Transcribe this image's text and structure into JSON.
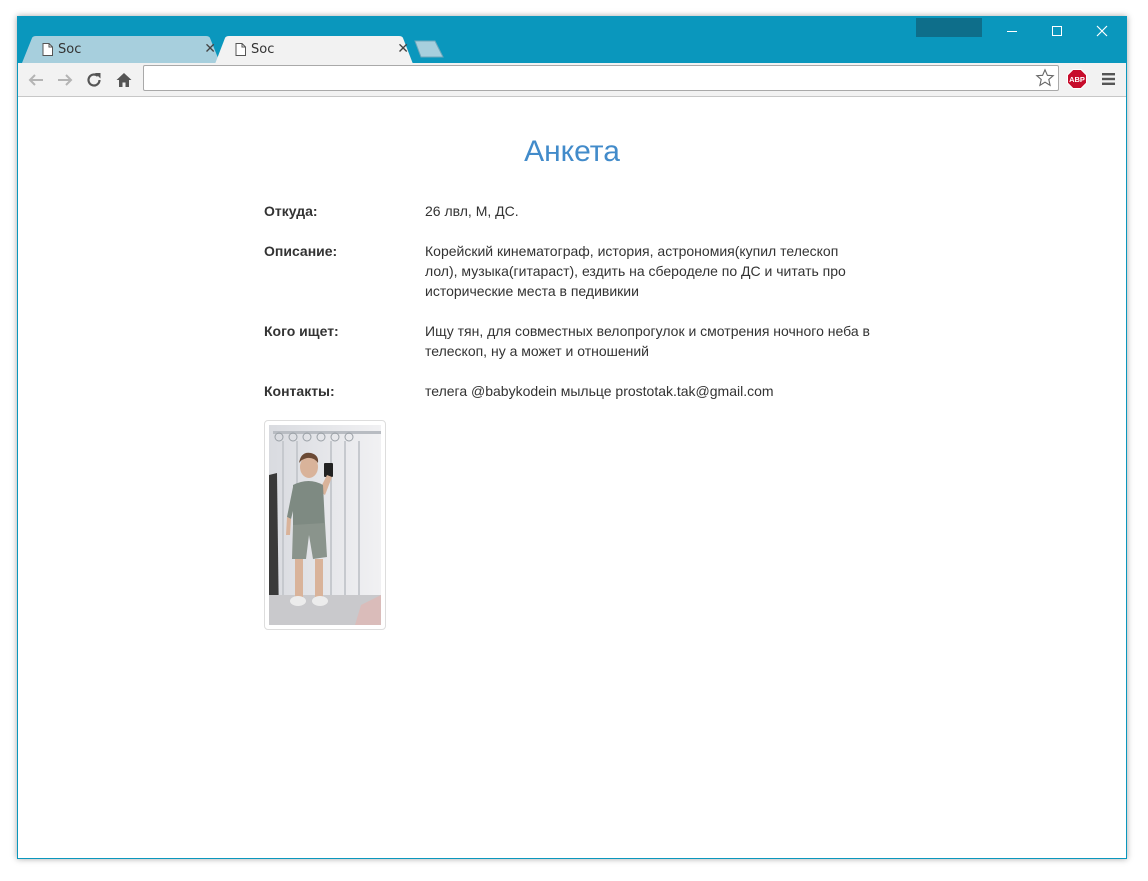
{
  "browser": {
    "tabs": [
      {
        "label": "Soc",
        "active": false
      },
      {
        "label": "Soc",
        "active": true
      }
    ],
    "address": {
      "value": "",
      "placeholder": ""
    },
    "extension": {
      "abp_label": "ABP"
    },
    "colors": {
      "frame": "#0a97bd",
      "accent_title": "#428bca"
    }
  },
  "page": {
    "title": "Анкета",
    "fields": [
      {
        "label": "Откуда:",
        "value": "26 лвл, М, ДС."
      },
      {
        "label": "Описание:",
        "value": "Корейский кинематограф, история, астрономия(купил телескоп лол), музыка(гитараст), ездить на сбероделе по ДС и читать про исторические места в педивикии"
      },
      {
        "label": "Кого ищет:",
        "value": "Ищу тян, для совместных велопрогулок и смотрения ночного неба в телескоп, ну а может и отношений"
      },
      {
        "label": "Контакты:",
        "value": "телега @babykodein мыльце prostotak.tak@gmail.com"
      }
    ],
    "photo": {
      "icon": "profile-photo"
    }
  }
}
